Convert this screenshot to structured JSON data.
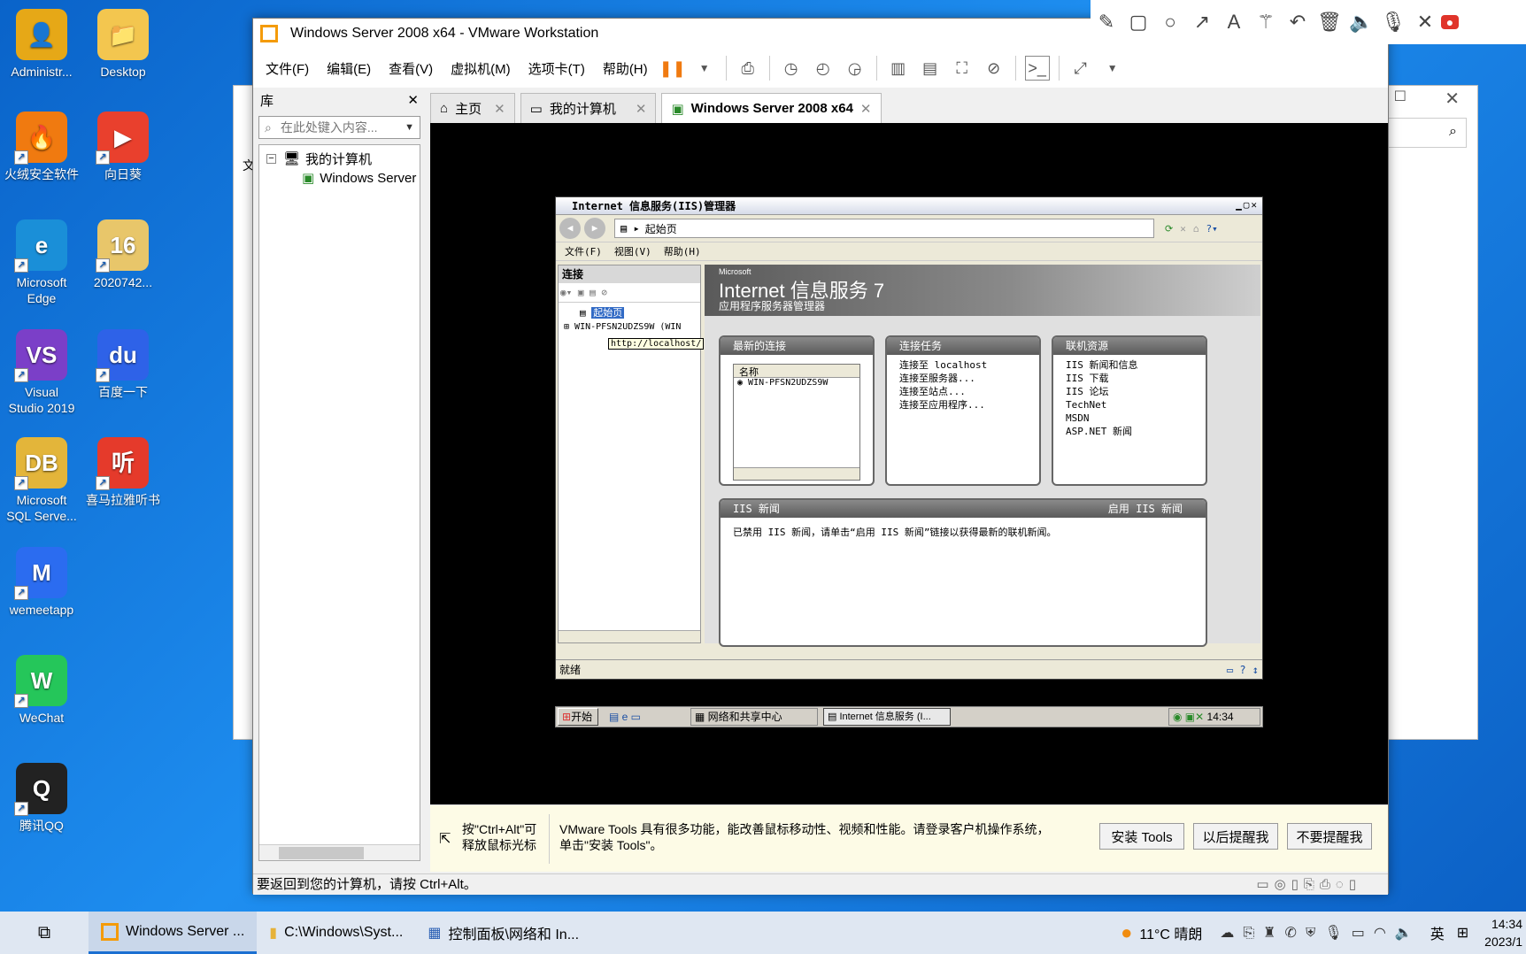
{
  "desktop_icons": [
    {
      "label": "Administr...",
      "color": "#e6a817",
      "glyph": "👤"
    },
    {
      "label": "Desktop",
      "color": "#f3c64f",
      "glyph": "📁"
    },
    {
      "label": "火绒安全软件",
      "color": "#f07a10",
      "glyph": "🔥"
    },
    {
      "label": "向日葵",
      "color": "#e9402d",
      "glyph": "▶"
    },
    {
      "label": "Microsoft\nEdge",
      "color": "#1a8fd8",
      "glyph": "e"
    },
    {
      "label": "2020742...",
      "color": "#e8c66a",
      "glyph": "16"
    },
    {
      "label": "Visual\nStudio 2019",
      "color": "#7b3fc8",
      "glyph": "VS"
    },
    {
      "label": "百度一下",
      "color": "#2e62e8",
      "glyph": "du"
    },
    {
      "label": "Microsoft\nSQL Serve...",
      "color": "#e3b53a",
      "glyph": "DB"
    },
    {
      "label": "喜马拉雅听书",
      "color": "#e53a2b",
      "glyph": "听"
    },
    {
      "label": "wemeetapp",
      "color": "#2b6cf0",
      "glyph": "M"
    },
    {
      "label": "WeChat",
      "color": "#25c65a",
      "glyph": "W"
    },
    {
      "label": "腾讯QQ",
      "color": "#222222",
      "glyph": "Q"
    }
  ],
  "vm": {
    "title": "Windows Server 2008 x64 - VMware Workstation",
    "menu": [
      "文件(F)",
      "编辑(E)",
      "查看(V)",
      "虚拟机(M)",
      "选项卡(T)",
      "帮助(H)"
    ],
    "library": {
      "title": "库",
      "search_placeholder": "在此处键入内容...",
      "tree_root": "我的计算机",
      "tree_child": "Windows Server"
    },
    "tabs": [
      {
        "label": "主页"
      },
      {
        "label": "我的计算机"
      },
      {
        "label": "Windows Server 2008 x64"
      }
    ],
    "tools_hint": {
      "left": "按\"Ctrl+Alt\"可\n释放鼠标光标",
      "main": "VMware Tools 具有很多功能，能改善鼠标移动性、视频和性能。请登录客户机操作系统，\n单击\"安装 Tools\"。",
      "install": "安装 Tools",
      "later": "以后提醒我",
      "never": "不要提醒我"
    },
    "status": "要返回到您的计算机，请按 Ctrl+Alt。"
  },
  "iis": {
    "title": "Internet 信息服务(IIS)管理器",
    "address": "起始页",
    "menu": [
      "文件(F)",
      "视图(V)",
      "帮助(H)"
    ],
    "conn_header": "连接",
    "tree_start": "起始页",
    "tree_server": "WIN-PFSN2UDZS9W (WIN",
    "tooltip": "http://localhost/",
    "banner_small": "Microsoft",
    "banner_title": "Internet 信息服务 7",
    "banner_sub": "应用程序服务器管理器",
    "recent": {
      "header": "最新的连接",
      "col": "名称",
      "row": "WIN-PFSN2UDZS9W"
    },
    "tasks": {
      "header": "连接任务",
      "items": [
        "连接至 localhost",
        "连接至服务器...",
        "连接至站点...",
        "连接至应用程序..."
      ]
    },
    "online": {
      "header": "联机资源",
      "items": [
        "IIS 新闻和信息",
        "IIS 下载",
        "IIS 论坛",
        "TechNet",
        "MSDN",
        "ASP.NET 新闻"
      ]
    },
    "news": {
      "header": "IIS 新闻",
      "enable": "启用 IIS 新闻",
      "text": "已禁用 IIS 新闻，请单击“启用 IIS 新闻”链接以获得最新的联机新闻。"
    },
    "status": "就绪",
    "taskbar": {
      "start": "开始",
      "item1": "网络和共享中心",
      "item2": "Internet 信息服务 (I...",
      "clock": "14:34"
    }
  },
  "taskbar": {
    "items": [
      "Windows Server ...",
      "C:\\Windows\\Syst...",
      "控制面板\\网络和 In..."
    ],
    "weather": "11°C 晴朗",
    "ime": "英",
    "time": "14:34",
    "date": "2023/1"
  }
}
